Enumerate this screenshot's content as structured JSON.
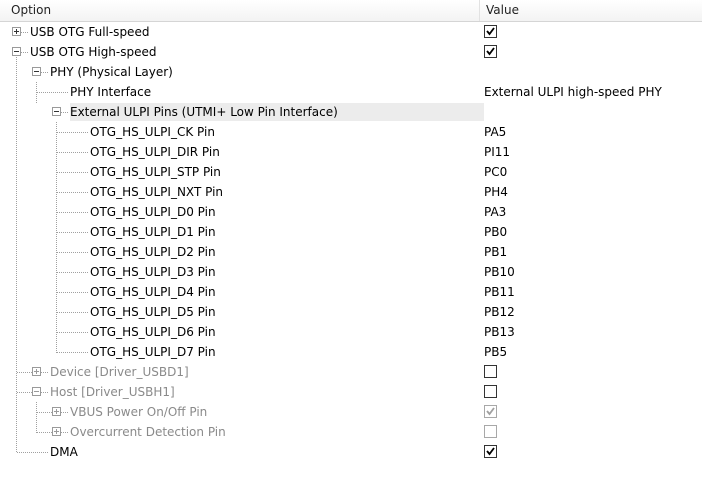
{
  "header": {
    "option": "Option",
    "value": "Value"
  },
  "rows": [
    {
      "label": "USB OTG Full-speed",
      "value_type": "checkbox",
      "checked": true
    },
    {
      "label": "USB OTG High-speed",
      "value_type": "checkbox",
      "checked": true
    },
    {
      "label": "PHY (Physical Layer)"
    },
    {
      "label": "PHY Interface",
      "value": "External ULPI high-speed PHY"
    },
    {
      "label": "External ULPI Pins (UTMI+ Low Pin Interface)",
      "selected": true
    },
    {
      "label": "OTG_HS_ULPI_CK Pin",
      "value": "PA5"
    },
    {
      "label": "OTG_HS_ULPI_DIR Pin",
      "value": "PI11"
    },
    {
      "label": "OTG_HS_ULPI_STP Pin",
      "value": "PC0"
    },
    {
      "label": "OTG_HS_ULPI_NXT Pin",
      "value": "PH4"
    },
    {
      "label": "OTG_HS_ULPI_D0 Pin",
      "value": "PA3"
    },
    {
      "label": "OTG_HS_ULPI_D1 Pin",
      "value": "PB0"
    },
    {
      "label": "OTG_HS_ULPI_D2 Pin",
      "value": "PB1"
    },
    {
      "label": "OTG_HS_ULPI_D3 Pin",
      "value": "PB10"
    },
    {
      "label": "OTG_HS_ULPI_D4 Pin",
      "value": "PB11"
    },
    {
      "label": "OTG_HS_ULPI_D5 Pin",
      "value": "PB12"
    },
    {
      "label": "OTG_HS_ULPI_D6 Pin",
      "value": "PB13"
    },
    {
      "label": "OTG_HS_ULPI_D7 Pin",
      "value": "PB5"
    },
    {
      "label": "Device [Driver_USBD1]",
      "value_type": "checkbox",
      "checked": false,
      "disabled": true
    },
    {
      "label": "Host [Driver_USBH1]",
      "value_type": "checkbox",
      "checked": false,
      "disabled": true
    },
    {
      "label": "VBUS Power On/Off Pin",
      "value_type": "checkbox",
      "checked": true,
      "disabled": true
    },
    {
      "label": "Overcurrent Detection Pin",
      "value_type": "checkbox",
      "checked": false,
      "disabled": true
    },
    {
      "label": "DMA",
      "value_type": "checkbox",
      "checked": true
    }
  ]
}
